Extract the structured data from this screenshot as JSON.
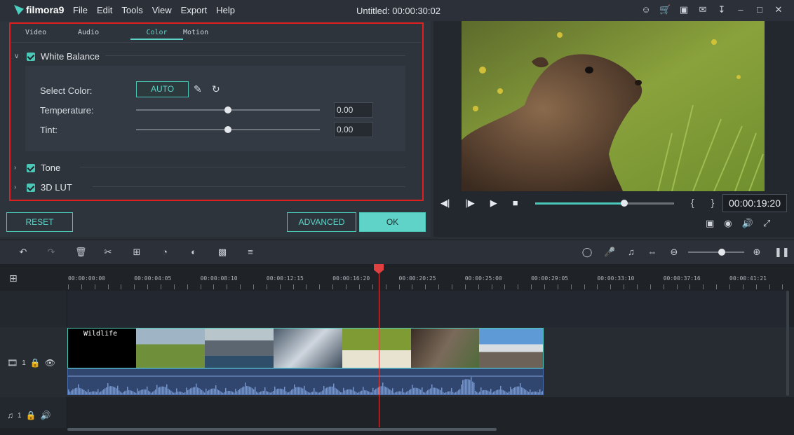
{
  "app": {
    "logo_text": "filmora9",
    "window_title": "Untitled: 00:00:30:02"
  },
  "menu": [
    "File",
    "Edit",
    "Tools",
    "View",
    "Export",
    "Help"
  ],
  "window_icons": [
    "user-icon",
    "cart-icon",
    "save-icon",
    "mail-icon",
    "download-icon",
    "minimize-icon",
    "maximize-icon",
    "close-icon"
  ],
  "tabs": [
    {
      "label": "Video",
      "active": false
    },
    {
      "label": "Audio",
      "active": false
    },
    {
      "label": "Color",
      "active": true
    },
    {
      "label": "Motion",
      "active": false
    }
  ],
  "white_balance": {
    "title": "White Balance",
    "select_color_label": "Select Color:",
    "auto_label": "AUTO",
    "temperature_label": "Temperature:",
    "temperature_value": "0.00",
    "temperature_level": 0.5,
    "tint_label": "Tint:",
    "tint_value": "0.00",
    "tint_level": 0.5
  },
  "sections": {
    "tone": "Tone",
    "lut": "3D LUT"
  },
  "buttons": {
    "reset": "RESET",
    "advanced": "ADVANCED",
    "ok": "OK"
  },
  "preview": {
    "timecode": "00:00:19:20",
    "progress": 0.64,
    "brackets": "{ }"
  },
  "timeline": {
    "ruler_labels": [
      "00:00:00:00",
      "00:00:04:05",
      "00:00:08:10",
      "00:00:12:15",
      "00:00:16:20",
      "00:00:20:25",
      "00:00:25:00",
      "00:00:29:05",
      "00:00:33:10",
      "00:00:37:16",
      "00:00:41:21"
    ],
    "clip_title": "Wildlife",
    "video_track_num": "1",
    "audio_track_num": "1"
  },
  "colors": {
    "accent": "#4bc8b8",
    "highlight_box": "#e02020",
    "playhead": "#e04040"
  }
}
